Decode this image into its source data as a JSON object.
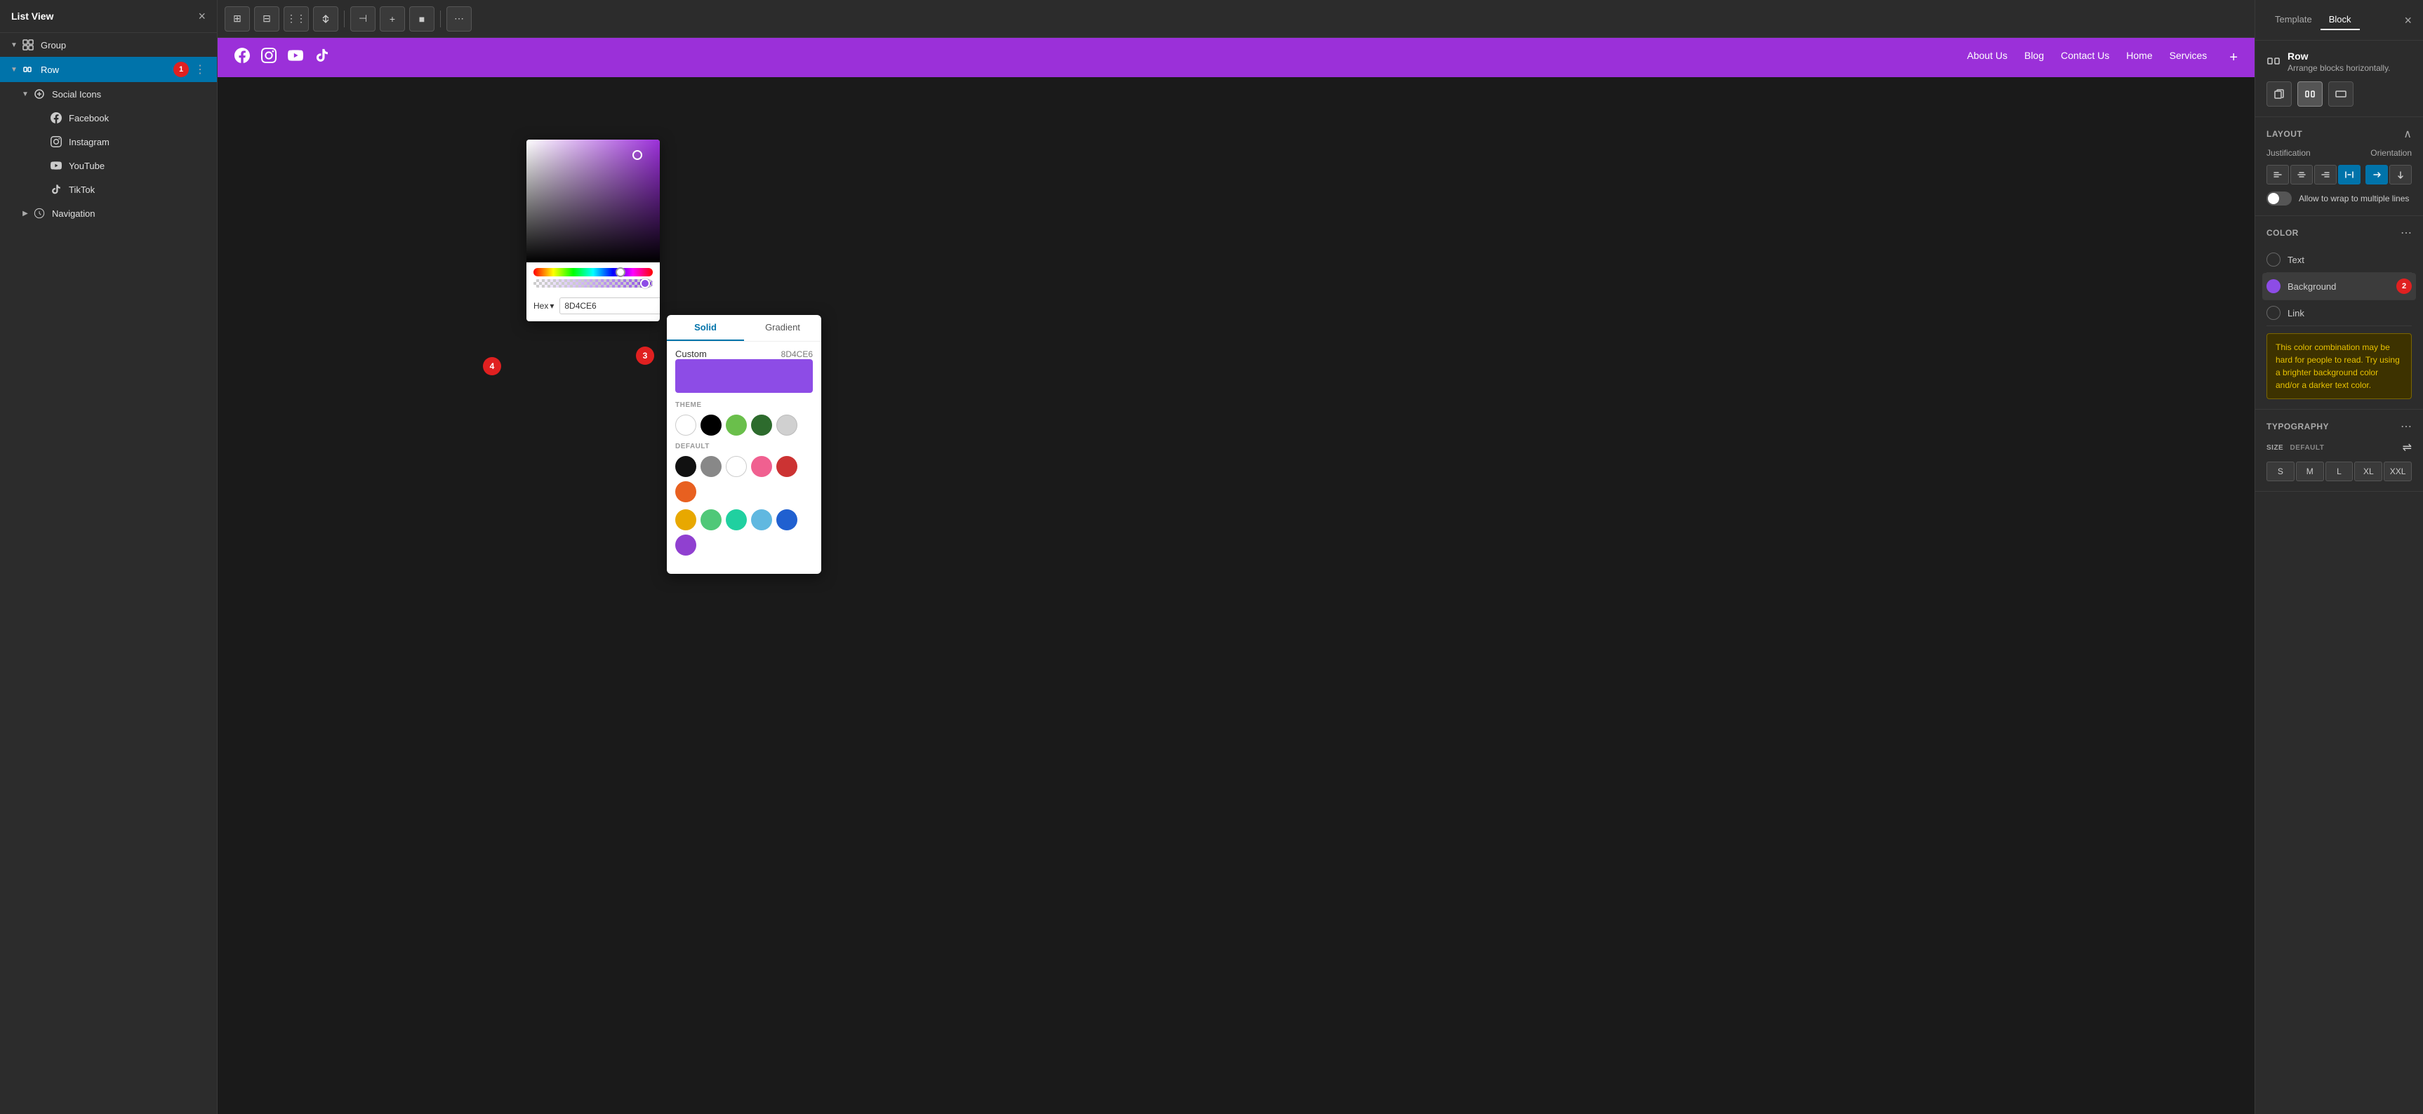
{
  "leftPanel": {
    "title": "List View",
    "closeBtn": "×",
    "tree": [
      {
        "level": 0,
        "type": "group",
        "label": "Group",
        "icon": "group-icon",
        "expanded": true,
        "badge": null
      },
      {
        "level": 0,
        "type": "row",
        "label": "Row",
        "icon": "row-icon",
        "expanded": true,
        "badge": "1",
        "selected": true
      },
      {
        "level": 1,
        "type": "social-icons",
        "label": "Social Icons",
        "icon": "social-icons-icon",
        "expanded": true
      },
      {
        "level": 2,
        "type": "facebook",
        "label": "Facebook",
        "icon": "facebook-icon"
      },
      {
        "level": 2,
        "type": "instagram",
        "label": "Instagram",
        "icon": "instagram-icon"
      },
      {
        "level": 2,
        "type": "youtube",
        "label": "YouTube",
        "icon": "youtube-icon"
      },
      {
        "level": 2,
        "type": "tiktok",
        "label": "TikTok",
        "icon": "tiktok-icon"
      },
      {
        "level": 1,
        "type": "navigation",
        "label": "Navigation",
        "icon": "navigation-icon"
      }
    ]
  },
  "toolbar": {
    "buttons": [
      "⊞",
      "⊟",
      "⋮⋮",
      "⌃",
      "⊣",
      "+",
      "■",
      "⋯"
    ]
  },
  "preview": {
    "navLinks": [
      "About Us",
      "Blog",
      "Contact Us",
      "Home",
      "Services"
    ],
    "socialIcons": [
      "facebook",
      "instagram",
      "youtube",
      "tiktok"
    ]
  },
  "colorPicker": {
    "hexLabel": "Hex",
    "hexValue": "8D4CE6",
    "copyBtn": "⧉"
  },
  "solidGradient": {
    "tabs": [
      "Solid",
      "Gradient"
    ],
    "activeTab": "Solid",
    "customLabel": "Custom",
    "customValue": "8D4CE6",
    "themeLabel": "THEME",
    "themeColors": [
      {
        "color": "#ffffff",
        "white": true
      },
      {
        "color": "#000000"
      },
      {
        "color": "#6abf4b"
      },
      {
        "color": "#2d6b2d"
      },
      {
        "color": "#d0d0d0"
      }
    ],
    "defaultLabel": "DEFAULT",
    "defaultColors": [
      {
        "color": "#111111"
      },
      {
        "color": "#888888"
      },
      {
        "color": "#ffffff",
        "white": true
      },
      {
        "color": "#f06090"
      },
      {
        "color": "#cc3333"
      },
      {
        "color": "#e86020"
      },
      {
        "color": "#e8a800"
      },
      {
        "color": "#50c878"
      },
      {
        "color": "#20d0a0"
      },
      {
        "color": "#60b8e0"
      },
      {
        "color": "#2060d0"
      },
      {
        "color": "#9040d0"
      }
    ]
  },
  "stepBadges": {
    "badge2": "2",
    "badge3": "3",
    "badge4": "4"
  },
  "rightPanel": {
    "tabs": [
      "Template",
      "Block"
    ],
    "activeTab": "Block",
    "closeBtn": "×",
    "blockTitle": "Row",
    "blockSubtitle": "Arrange blocks horizontally.",
    "layoutLabel": "Layout",
    "justificationLabel": "Justification",
    "orientationLabel": "Orientation",
    "justificationBtns": [
      "⊣",
      "⊢",
      "⊡",
      "⊟"
    ],
    "orientationBtns": [
      "→",
      "↓"
    ],
    "wrapLabel": "Allow to wrap to multiple lines",
    "colorLabel": "Color",
    "colorOptions": [
      {
        "label": "Text",
        "colorClass": "empty",
        "active": false
      },
      {
        "label": "Background",
        "colorClass": "purple",
        "active": true
      },
      {
        "label": "Link",
        "colorClass": "empty",
        "active": false
      }
    ],
    "warningText": "This color combination may be hard for people to read. Try using a brighter background color and/or a darker text color.",
    "typographyLabel": "Typography",
    "sizeLabel": "SIZE",
    "sizeDefault": "DEFAULT",
    "sizeBtns": [
      "S",
      "M",
      "L",
      "XL",
      "XXL"
    ]
  }
}
